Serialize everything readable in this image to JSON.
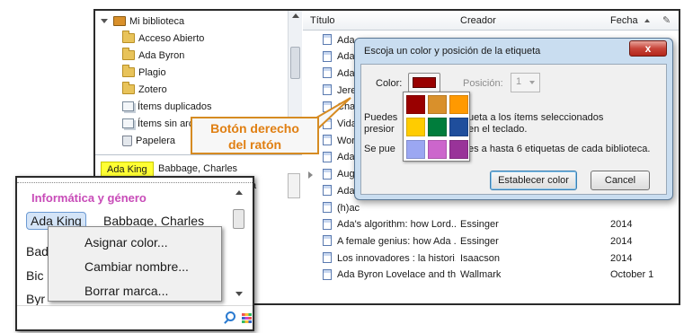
{
  "library": {
    "root": "Mi biblioteca",
    "collections": [
      "Acceso Abierto",
      "Ada Byron",
      "Plagio",
      "Zotero"
    ],
    "duplicates": "Ítems duplicados",
    "unfiled": "Ítems sin arc",
    "trash": "Papelera"
  },
  "tags": {
    "colored_tag": "Ada King",
    "plain_tag": "Babbage, Charles",
    "partial_right": "a",
    "partial_ra": "ra"
  },
  "items": {
    "columns": {
      "title": "Título",
      "creator": "Creador",
      "date": "Fecha"
    },
    "rows": [
      {
        "title": "Ada",
        "creator": "",
        "date": ""
      },
      {
        "title": "Ada",
        "creator": "",
        "date": ""
      },
      {
        "title": "Ada",
        "creator": "",
        "date": ""
      },
      {
        "title": "Jere",
        "creator": "",
        "date": ""
      },
      {
        "title": "Cha",
        "creator": "",
        "date": ""
      },
      {
        "title": "Vida",
        "creator": "",
        "date": ""
      },
      {
        "title": "Wor",
        "creator": "",
        "date": ""
      },
      {
        "title": "Ada",
        "creator": "",
        "date": ""
      },
      {
        "title": "Aug",
        "creator": "",
        "date": ""
      },
      {
        "title": "Ada",
        "creator": "",
        "date": ""
      },
      {
        "title": "(h)ac",
        "creator": "",
        "date": ""
      },
      {
        "title": "Ada's algorithm: how Lord...",
        "creator": "Essinger",
        "date": "2014"
      },
      {
        "title": "A female genius: how Ada ...",
        "creator": "Essinger",
        "date": "2014"
      },
      {
        "title": "Los innovadores : la histori...",
        "creator": "Isaacson",
        "date": "2014"
      },
      {
        "title": "Ada Byron Lovelace and th...",
        "creator": "Wallmark",
        "date": "October 1"
      }
    ]
  },
  "dialog": {
    "title": "Escoja un color y posición de la etiqueta",
    "close": "x",
    "color_label": "Color:",
    "position_label": "Posición:",
    "position_value": "1",
    "text_1a": "Puedes",
    "text_1b": "ueta a los ítems seleccionados",
    "text_2a": "presior",
    "text_2b": "en el teclado.",
    "text_3a": "Se pue",
    "text_3b": "es a hasta 6 etiquetas de cada biblioteca.",
    "set_button": "Establecer color",
    "cancel_button": "Cancel",
    "selected_color": "#990000",
    "palette": [
      "#990000",
      "#d9902b",
      "#ff9900",
      "#ffcc00",
      "#007d3c",
      "#1f4e9c",
      "#9ba7f2",
      "#cc66cc",
      "#993399"
    ]
  },
  "callout": {
    "line1": "Botón derecho",
    "line2": "del ratón"
  },
  "zoom": {
    "heading": "Informática y género",
    "tag_blue": "Ada King",
    "tag_plain": "Babbage, Charles",
    "left_1": "Bad",
    "left_2": "Bic",
    "left_3": "Byr"
  },
  "context_menu": [
    "Asignar color...",
    "Cambiar nombre...",
    "Borrar marca..."
  ]
}
